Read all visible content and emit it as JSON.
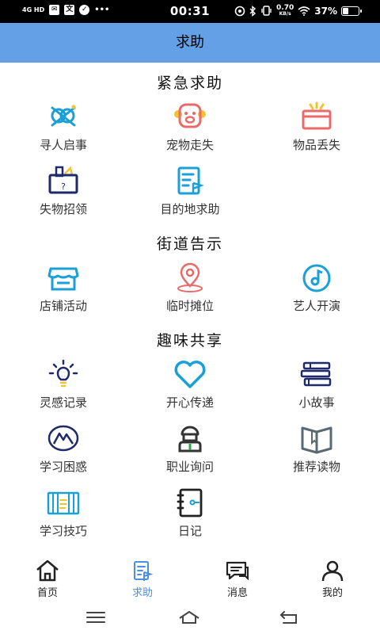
{
  "status_bar": {
    "network": "4G HD",
    "icon_mail": "✉",
    "icon_app": "文",
    "icon_check": "✓",
    "more": "•••",
    "time": "00:31",
    "speed_value": "0.70",
    "speed_unit": "KB/s",
    "battery": "37%"
  },
  "header": {
    "title": "求助"
  },
  "sections": [
    {
      "title": "紧急求助",
      "items": [
        {
          "label": "寻人启事",
          "icon": "people-search-icon"
        },
        {
          "label": "宠物走失",
          "icon": "pet-icon"
        },
        {
          "label": "物品丢失",
          "icon": "lost-item-icon"
        },
        {
          "label": "失物招领",
          "icon": "lost-found-box-icon"
        },
        {
          "label": "目的地求助",
          "icon": "destination-flag-icon"
        }
      ]
    },
    {
      "title": "街道告示",
      "items": [
        {
          "label": "店铺活动",
          "icon": "shop-icon"
        },
        {
          "label": "临时摊位",
          "icon": "location-pin-icon"
        },
        {
          "label": "艺人开演",
          "icon": "music-note-icon"
        }
      ]
    },
    {
      "title": "趣味共享",
      "items": [
        {
          "label": "灵感记录",
          "icon": "lightbulb-icon"
        },
        {
          "label": "开心传递",
          "icon": "heart-icon"
        },
        {
          "label": "小故事",
          "icon": "books-stack-icon"
        },
        {
          "label": "学习困惑",
          "icon": "mountain-badge-icon"
        },
        {
          "label": "职业询问",
          "icon": "worker-icon"
        },
        {
          "label": "推荐读物",
          "icon": "open-book-icon"
        },
        {
          "label": "学习技巧",
          "icon": "notebook-icon"
        },
        {
          "label": "日记",
          "icon": "diary-icon"
        }
      ]
    }
  ],
  "bottom_nav": [
    {
      "label": "首页",
      "icon": "home-icon"
    },
    {
      "label": "求助",
      "icon": "help-doc-icon",
      "active": true
    },
    {
      "label": "消息",
      "icon": "message-icon"
    },
    {
      "label": "我的",
      "icon": "profile-icon"
    }
  ],
  "colors": {
    "header_bg": "#64a0e6",
    "icon_teal": "#1a9fd6",
    "icon_red": "#e96a6a",
    "icon_yellow": "#f3c431",
    "icon_navy": "#1e2a6a",
    "nav_active": "#4a8fe0"
  }
}
